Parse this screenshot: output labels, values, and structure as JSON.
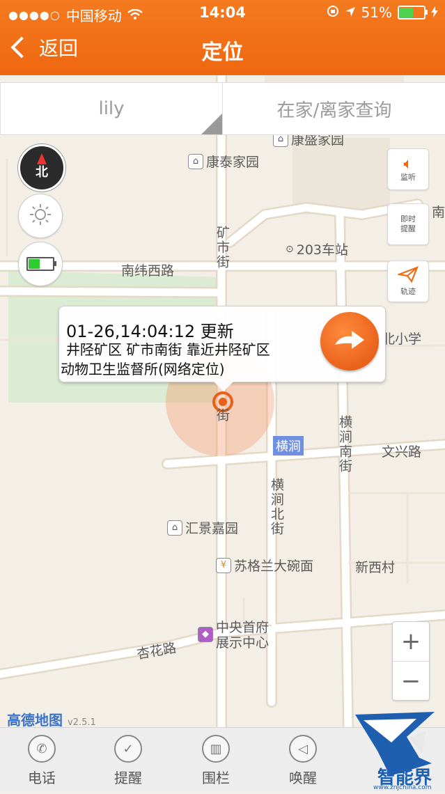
{
  "status": {
    "dots": "●●●●○",
    "carrier": "中国移动",
    "time": "14:04",
    "battery": "51%"
  },
  "nav": {
    "back": "返回",
    "title": "定位"
  },
  "selectors": {
    "device": "lily",
    "query": "在家/离家查询"
  },
  "compass": {
    "label": "北"
  },
  "actions": {
    "monitor": "监听",
    "remind": "即时\n提醒",
    "track": "轨迹"
  },
  "map_labels": {
    "kangsheng": "康盛家园",
    "kangtai": "康泰家园",
    "kuangshi_street": "矿市街",
    "station": "203车站",
    "nanwei_west": "南纬西路",
    "nan_edge": "南",
    "xiaoxue": "北小学",
    "hengjian_badge": "横涧",
    "hengjian_south": "横涧南街",
    "wenxing": "文兴路",
    "hengjian_north": "横涧北街",
    "huijing": "汇景嘉园",
    "sugelan": "苏格兰大碗面",
    "xinxicun": "新西村",
    "zhongyang": "中央首府\n展示中心",
    "xinghua": "杏花路",
    "jie": "街"
  },
  "popup": {
    "time": "01-26,14:04:12 更新",
    "address1": "井陉矿区 矿市南街 靠近井陉矿区",
    "address2": "动物卫生监督所(网络定位)"
  },
  "zoom": {
    "in": "+",
    "out": "−"
  },
  "map_brand": {
    "name": "高德地图",
    "version": "v2.5.1"
  },
  "tabs": [
    {
      "label": "电话",
      "icon": "phone-icon"
    },
    {
      "label": "提醒",
      "icon": "alarm-icon"
    },
    {
      "label": "围栏",
      "icon": "fence-icon"
    },
    {
      "label": "唤醒",
      "icon": "speaker-icon"
    }
  ],
  "watermark": {
    "name": "智能界",
    "url": "www.znjchina.com"
  },
  "colors": {
    "accent": "#f06a12",
    "map_bg": "#f3efe7",
    "park": "#dcebd3"
  }
}
